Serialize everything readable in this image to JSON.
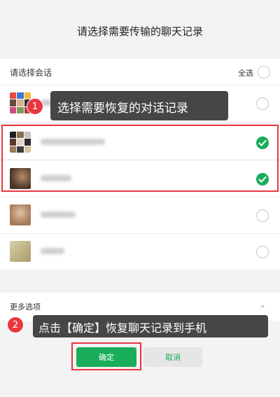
{
  "dialog": {
    "title": "请选择需要传输的聊天记录",
    "list_label": "请选择会话",
    "select_all_label": "全选",
    "more_options_label": "更多选项",
    "chevron": "⌄"
  },
  "conversations": [
    {
      "avatar": "group-avatar",
      "selected": false
    },
    {
      "avatar": "group-avatar",
      "selected": true
    },
    {
      "avatar": "photo-avatar",
      "selected": true
    },
    {
      "avatar": "photo-avatar",
      "selected": false
    },
    {
      "avatar": "photo-avatar",
      "selected": false
    }
  ],
  "buttons": {
    "confirm_label": "确定",
    "cancel_label": "取消"
  },
  "annotations": {
    "step1_number": "1",
    "step1_text": "选择需要恢复的对话记录",
    "step2_number": "2",
    "step2_text": "点击【确定】恢复聊天记录到手机"
  },
  "colors": {
    "accent_green": "#1aad5a",
    "highlight_red": "#e8373f",
    "callout_bg": "#3a3a3a"
  }
}
